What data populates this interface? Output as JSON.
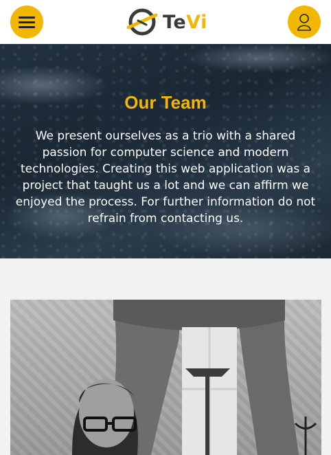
{
  "header": {
    "menu_icon": "hamburger-menu-icon",
    "logo_icon": "globe-plane-icon",
    "logo_text_primary": "Te",
    "logo_text_accent": "Vi",
    "user_icon": "user-icon",
    "accent_color": "#f2b705"
  },
  "hero": {
    "title": "Our Team",
    "description": "We present ourselves as a trio with a shared passion for computer science and modern technologies. Creating this web application was a project that taught us a lot and we can affirm we enjoyed the process. For further information do not refrain from contacting us."
  },
  "team": {
    "member_photo": "team-member-photo"
  }
}
